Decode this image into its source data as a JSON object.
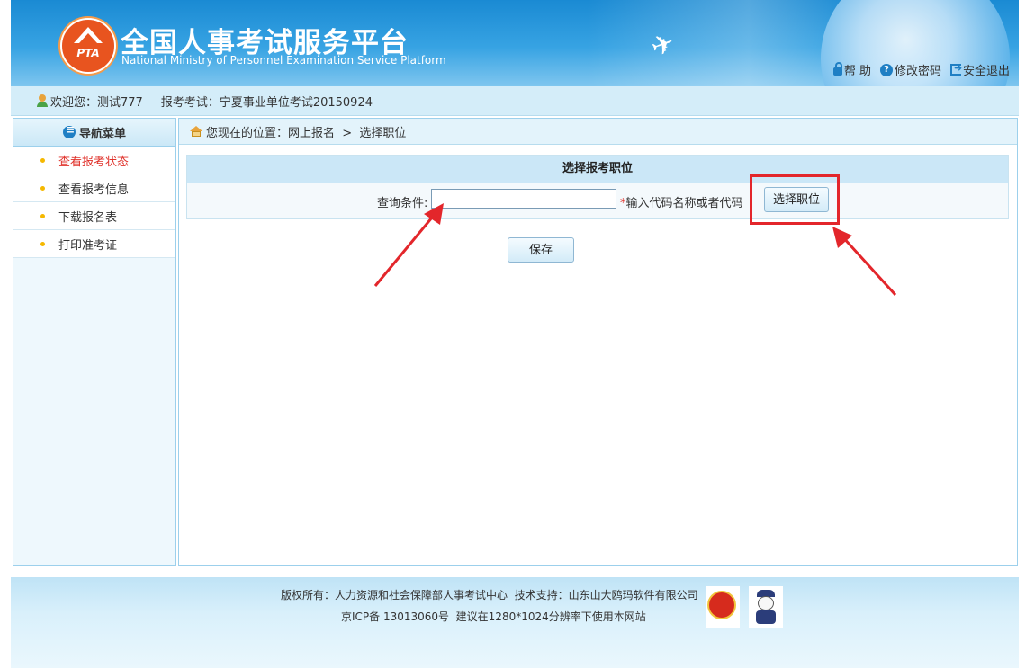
{
  "header": {
    "title": "全国人事考试服务平台",
    "subtitle": "National Ministry of Personnel Examination Service Platform",
    "logo_text": "PTA",
    "links": [
      {
        "label": "帮 助",
        "icon": "lock-icon"
      },
      {
        "label": "修改密码",
        "icon": "help-icon"
      },
      {
        "label": "安全退出",
        "icon": "exit-icon"
      }
    ]
  },
  "welcome": {
    "greeting": "欢迎您：测试777",
    "exam": "报考考试：宁夏事业单位考试20150924"
  },
  "sidebar": {
    "title": "导航菜单",
    "items": [
      {
        "label": "查看报考状态",
        "active": true
      },
      {
        "label": "查看报考信息",
        "active": false
      },
      {
        "label": "下载报名表",
        "active": false
      },
      {
        "label": "打印准考证",
        "active": false
      }
    ]
  },
  "breadcrumb": {
    "text": "您现在的位置：网上报名  >  选择职位"
  },
  "form": {
    "title": "选择报考职位",
    "query_label": "查询条件:",
    "query_value": "",
    "required_mark": "*",
    "hint": "输入代码名称或者代码",
    "select_button": "选择职位",
    "save_button": "保存"
  },
  "annotation": {
    "color": "#e3262b"
  },
  "footer": {
    "line1": "版权所有：人力资源和社会保障部人事考试中心  技术支持：山东山大鸥玛软件有限公司",
    "line2": "京ICP备 13013060号  建议在1280*1024分辨率下使用本网站"
  },
  "colors": {
    "header_blue": "#1a8ad3",
    "active_menu": "#e0322b",
    "accent": "#1f7fc4"
  }
}
